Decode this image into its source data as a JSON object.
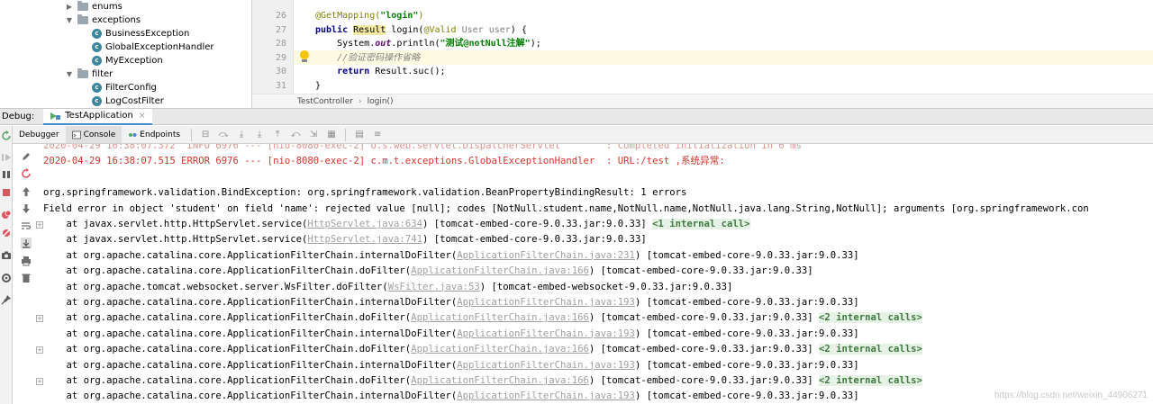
{
  "project_tree": [
    {
      "label": "enums",
      "type": "folder",
      "expanded": false,
      "indent": 1
    },
    {
      "label": "exceptions",
      "type": "folder",
      "expanded": true,
      "indent": 1
    },
    {
      "label": "BusinessException",
      "type": "class",
      "indent": 2
    },
    {
      "label": "GlobalExceptionHandler",
      "type": "class",
      "indent": 2
    },
    {
      "label": "MyException",
      "type": "class",
      "indent": 2
    },
    {
      "label": "filter",
      "type": "folder",
      "expanded": true,
      "indent": 1
    },
    {
      "label": "FilterConfig",
      "type": "class",
      "indent": 2
    },
    {
      "label": "LogCostFilter",
      "type": "class",
      "indent": 2
    }
  ],
  "editor": {
    "lines": [
      {
        "num": "26",
        "parts": [
          {
            "t": "@GetMapping(",
            "c": "ann"
          },
          {
            "t": "\"login\"",
            "c": "str"
          },
          {
            "t": ")",
            "c": "ann"
          }
        ]
      },
      {
        "num": "27",
        "parts": [
          {
            "t": "public ",
            "c": "kw"
          },
          {
            "t": "Result",
            "c": "type-hl"
          },
          {
            "t": " login(",
            "c": ""
          },
          {
            "t": "@Valid ",
            "c": "ann"
          },
          {
            "t": "User user",
            "c": "param"
          },
          {
            "t": ") {",
            "c": ""
          }
        ]
      },
      {
        "num": "28",
        "parts": [
          {
            "t": "    System.",
            "c": ""
          },
          {
            "t": "out",
            "c": "field"
          },
          {
            "t": ".println(",
            "c": ""
          },
          {
            "t": "\"测试@notNull注解\"",
            "c": "str"
          },
          {
            "t": ");",
            "c": ""
          }
        ]
      },
      {
        "num": "29",
        "parts": [
          {
            "t": "    //验证密码操作省略",
            "c": "cmt"
          }
        ]
      },
      {
        "num": "30",
        "parts": [
          {
            "t": "    ",
            "c": ""
          },
          {
            "t": "return ",
            "c": "kw"
          },
          {
            "t": "Result.",
            "c": ""
          },
          {
            "t": "suc",
            "c": ""
          },
          {
            "t": "();",
            "c": ""
          }
        ]
      },
      {
        "num": "31",
        "parts": [
          {
            "t": "}",
            "c": ""
          }
        ]
      }
    ]
  },
  "breadcrumb": [
    "TestController",
    "login()"
  ],
  "debug_bar": {
    "label": "Debug:",
    "tab": "TestApplication"
  },
  "debug_tabs": [
    "Debugger",
    "Console",
    "Endpoints"
  ],
  "console": {
    "lines": [
      {
        "kind": "info-faded",
        "text": "2020-04-29 16:38:07.372  INFO 6976 --- [nio-8080-exec-2] o.s.web.servlet.DispatcherServlet        : Completed initialization in 6 ms"
      },
      {
        "kind": "err",
        "text": "2020-04-29 16:38:07.515 ERROR 6976 --- [nio-8080-exec-2] c.m.t.exceptions.GlobalExceptionHandler  : URL:/test ,系统异常:"
      },
      {
        "kind": "blank",
        "text": ""
      },
      {
        "kind": "plain",
        "text": "org.springframework.validation.BindException: org.springframework.validation.BeanPropertyBindingResult: 1 errors"
      },
      {
        "kind": "plain",
        "text": "Field error in object 'student' on field 'name': rejected value [null]; codes [NotNull.student.name,NotNull.name,NotNull.java.lang.String,NotNull]; arguments [org.springframework.con"
      },
      {
        "kind": "frame",
        "fold": true,
        "pre": "    at javax.servlet.http.HttpServlet.service(",
        "link": "HttpServlet.java:634",
        "post": ") [tomcat-embed-core-9.0.33.jar:9.0.33] ",
        "internal": "<1 internal call>"
      },
      {
        "kind": "frame",
        "pre": "    at javax.servlet.http.HttpServlet.service(",
        "link": "HttpServlet.java:741",
        "post": ") [tomcat-embed-core-9.0.33.jar:9.0.33]"
      },
      {
        "kind": "frame",
        "pre": "    at org.apache.catalina.core.ApplicationFilterChain.internalDoFilter(",
        "link": "ApplicationFilterChain.java:231",
        "post": ") [tomcat-embed-core-9.0.33.jar:9.0.33]"
      },
      {
        "kind": "frame",
        "pre": "    at org.apache.catalina.core.ApplicationFilterChain.doFilter(",
        "link": "ApplicationFilterChain.java:166",
        "post": ") [tomcat-embed-core-9.0.33.jar:9.0.33]"
      },
      {
        "kind": "frame",
        "pre": "    at org.apache.tomcat.websocket.server.WsFilter.doFilter(",
        "link": "WsFilter.java:53",
        "post": ") [tomcat-embed-websocket-9.0.33.jar:9.0.33]"
      },
      {
        "kind": "frame",
        "pre": "    at org.apache.catalina.core.ApplicationFilterChain.internalDoFilter(",
        "link": "ApplicationFilterChain.java:193",
        "post": ") [tomcat-embed-core-9.0.33.jar:9.0.33]"
      },
      {
        "kind": "frame",
        "fold": true,
        "pre": "    at org.apache.catalina.core.ApplicationFilterChain.doFilter(",
        "link": "ApplicationFilterChain.java:166",
        "post": ") [tomcat-embed-core-9.0.33.jar:9.0.33] ",
        "internal": "<2 internal calls>"
      },
      {
        "kind": "frame",
        "pre": "    at org.apache.catalina.core.ApplicationFilterChain.internalDoFilter(",
        "link": "ApplicationFilterChain.java:193",
        "post": ") [tomcat-embed-core-9.0.33.jar:9.0.33]"
      },
      {
        "kind": "frame",
        "fold": true,
        "pre": "    at org.apache.catalina.core.ApplicationFilterChain.doFilter(",
        "link": "ApplicationFilterChain.java:166",
        "post": ") [tomcat-embed-core-9.0.33.jar:9.0.33] ",
        "internal": "<2 internal calls>"
      },
      {
        "kind": "frame",
        "pre": "    at org.apache.catalina.core.ApplicationFilterChain.internalDoFilter(",
        "link": "ApplicationFilterChain.java:193",
        "post": ") [tomcat-embed-core-9.0.33.jar:9.0.33]"
      },
      {
        "kind": "frame",
        "fold": true,
        "pre": "    at org.apache.catalina.core.ApplicationFilterChain.doFilter(",
        "link": "ApplicationFilterChain.java:166",
        "post": ") [tomcat-embed-core-9.0.33.jar:9.0.33] ",
        "internal": "<2 internal calls>"
      },
      {
        "kind": "frame",
        "pre": "    at org.apache.catalina.core.ApplicationFilterChain.internalDoFilter(",
        "link": "ApplicationFilterChain.java:193",
        "post": ") [tomcat-embed-core-9.0.33.jar:9.0.33]"
      }
    ]
  },
  "watermark": "https://blog.csdn.net/weixin_44906271",
  "icons": {
    "left_toolbar": [
      "rerun-icon",
      "resume-icon",
      "pause-icon",
      "stop-icon",
      "view-breakpoints-icon",
      "mute-breakpoints-icon",
      "camera-icon",
      "settings-icon",
      "pin-icon"
    ],
    "console_side": [
      "edit-icon",
      "restart-icon",
      "up-arrow-icon",
      "down-arrow-icon",
      "soft-wrap-icon",
      "scroll-to-end-icon",
      "print-icon",
      "trash-icon"
    ]
  }
}
